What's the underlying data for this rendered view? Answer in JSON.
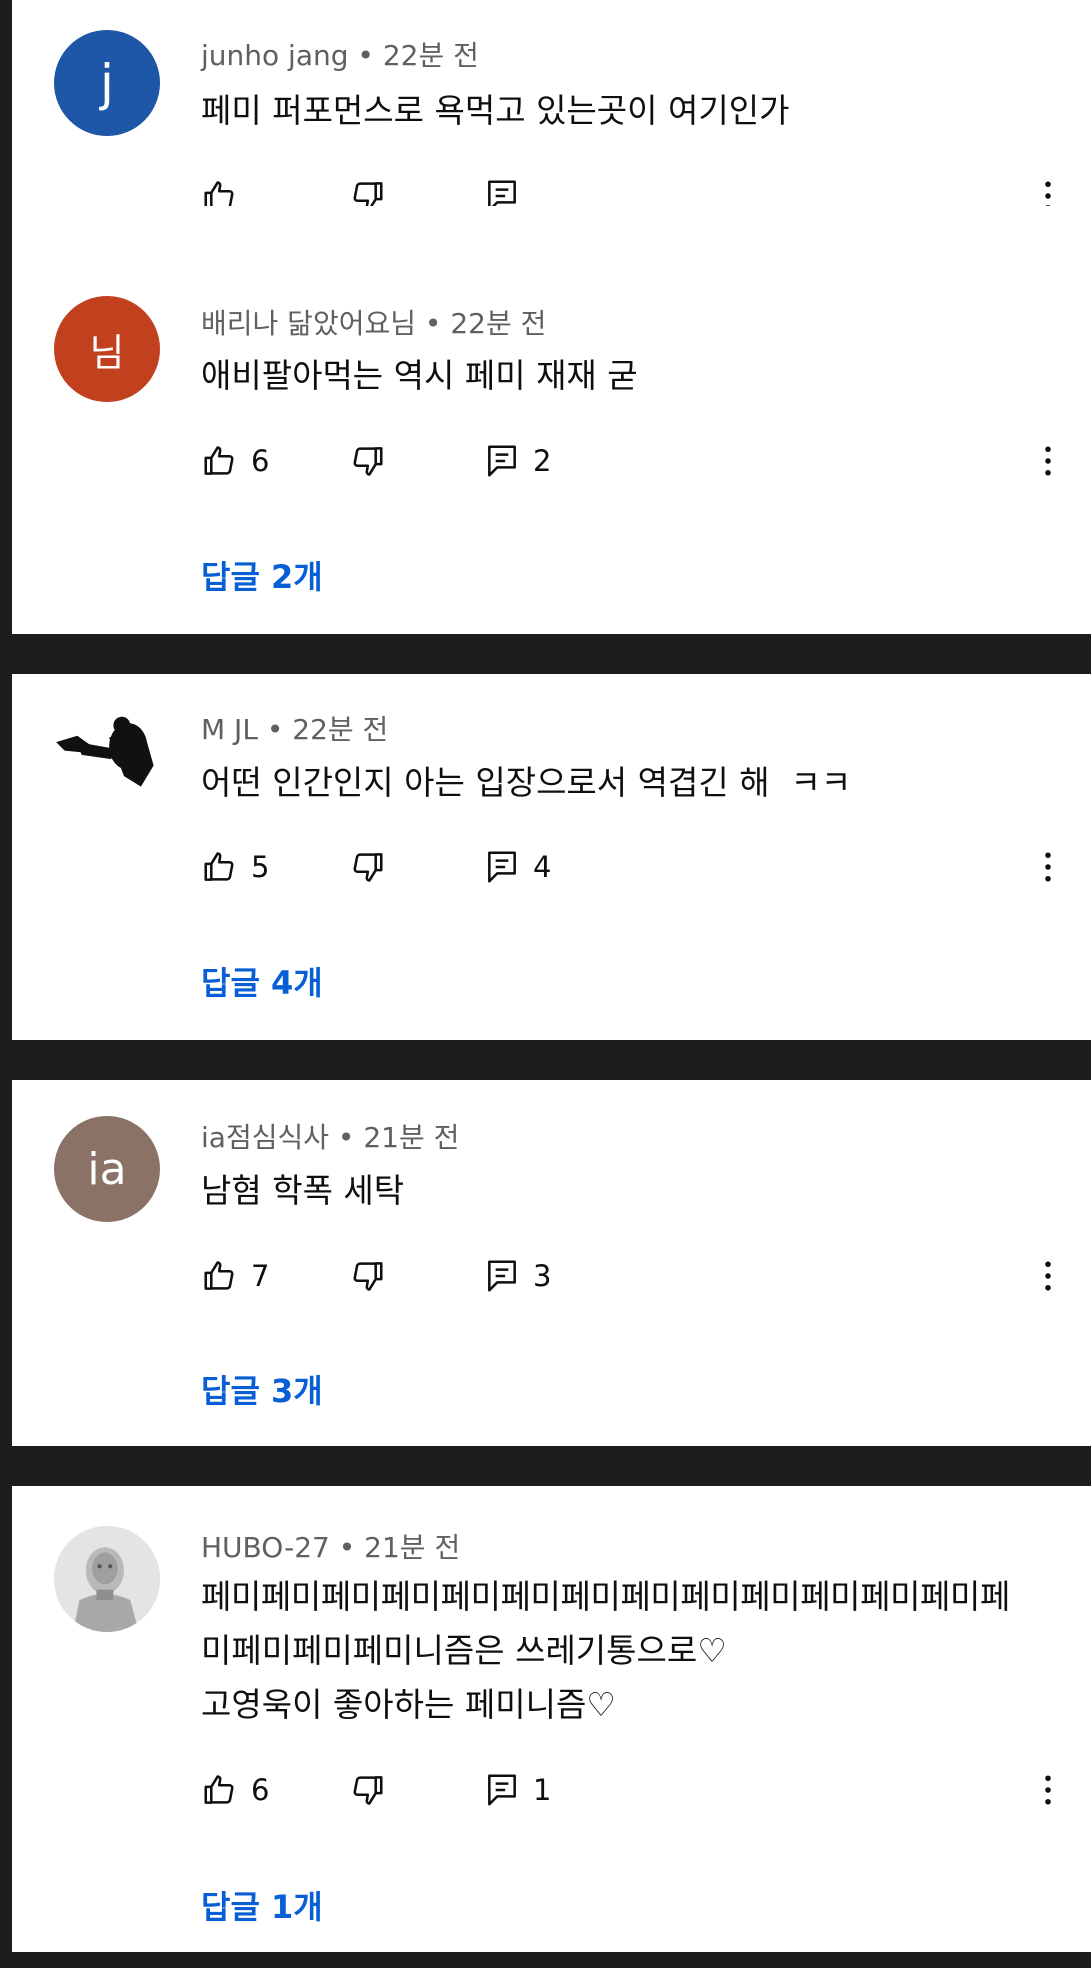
{
  "comments": [
    {
      "author": "junho jang",
      "time": "22분 전",
      "text": "페미 퍼포먼스로 욕먹고 있는곳이 여기인가",
      "avatar_letter": "j",
      "avatar_color": "#1e56a8",
      "likes": "",
      "replies": "",
      "replies_link": ""
    },
    {
      "author": "배리나 닮았어요님",
      "time": "22분 전",
      "text": "애비팔아먹는 역시 페미 재재 굳",
      "avatar_letter": "님",
      "avatar_color": "#c1411f",
      "likes": "6",
      "replies": "2",
      "replies_link": "답글 2개"
    },
    {
      "author": "M JL",
      "time": "22분 전",
      "text": "어떤 인간인지 아는 입장으로서 역겹긴 해  ㅋㅋ",
      "avatar_letter": "",
      "avatar_color": "#ffffff",
      "likes": "5",
      "replies": "4",
      "replies_link": "답글 4개"
    },
    {
      "author": "ia점심식사",
      "time": "21분 전",
      "text": "남혐 학폭 세탁",
      "avatar_letter": "ia",
      "avatar_color": "#8a7267",
      "likes": "7",
      "replies": "3",
      "replies_link": "답글 3개"
    },
    {
      "author": "HUBO-27",
      "time": "21분 전",
      "text_lines": [
        "페미페미페미페미페미페미페미페미페미페미페미페미페미페",
        "미페미페미페미니즘은 쓰레기통으로♡",
        "고영욱이 좋아하는 페미니즘♡"
      ],
      "avatar_letter": "",
      "avatar_color": "#d9d9d9",
      "likes": "6",
      "replies": "1",
      "replies_link": "답글 1개"
    }
  ],
  "separator": "•",
  "colors": {
    "link": "#065fd4",
    "meta": "#606060",
    "text": "#0f0f0f",
    "background_gap": "#1c1c1c"
  },
  "icons": [
    "like-icon",
    "dislike-icon",
    "reply-icon",
    "more-vert-icon"
  ]
}
